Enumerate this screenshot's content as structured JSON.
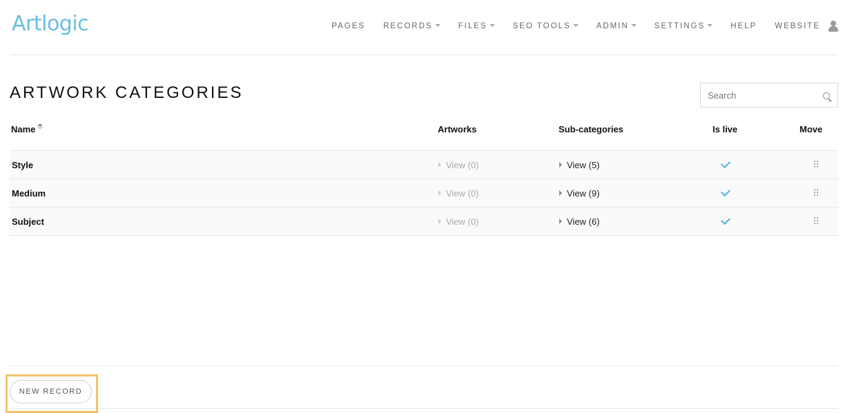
{
  "header": {
    "logo": "Artlogic",
    "nav": [
      {
        "label": "PAGES",
        "dropdown": false
      },
      {
        "label": "RECORDS",
        "dropdown": true
      },
      {
        "label": "FILES",
        "dropdown": true
      },
      {
        "label": "SEO TOOLS",
        "dropdown": true
      },
      {
        "label": "ADMIN",
        "dropdown": true
      },
      {
        "label": "SETTINGS",
        "dropdown": true
      },
      {
        "label": "HELP",
        "dropdown": false
      },
      {
        "label": "WEBSITE",
        "dropdown": false
      }
    ],
    "user_icon": "user-icon"
  },
  "main": {
    "title": "ARTWORK CATEGORIES",
    "search": {
      "placeholder": "Search",
      "value": ""
    },
    "table": {
      "columns": [
        "Name",
        "Artworks",
        "Sub-categories",
        "Is live",
        "Move"
      ],
      "sorted_by": "Name",
      "rows": [
        {
          "name": "Style",
          "artworks": "View (0)",
          "subcategories": "View (5)",
          "is_live": true
        },
        {
          "name": "Medium",
          "artworks": "View (0)",
          "subcategories": "View (9)",
          "is_live": true
        },
        {
          "name": "Subject",
          "artworks": "View (0)",
          "subcategories": "View (6)",
          "is_live": true
        }
      ]
    }
  },
  "footer": {
    "new_record_label": "NEW RECORD"
  },
  "colors": {
    "logo": "#6bbde3",
    "check": "#4db3e6",
    "highlight": "#f5c26b"
  }
}
